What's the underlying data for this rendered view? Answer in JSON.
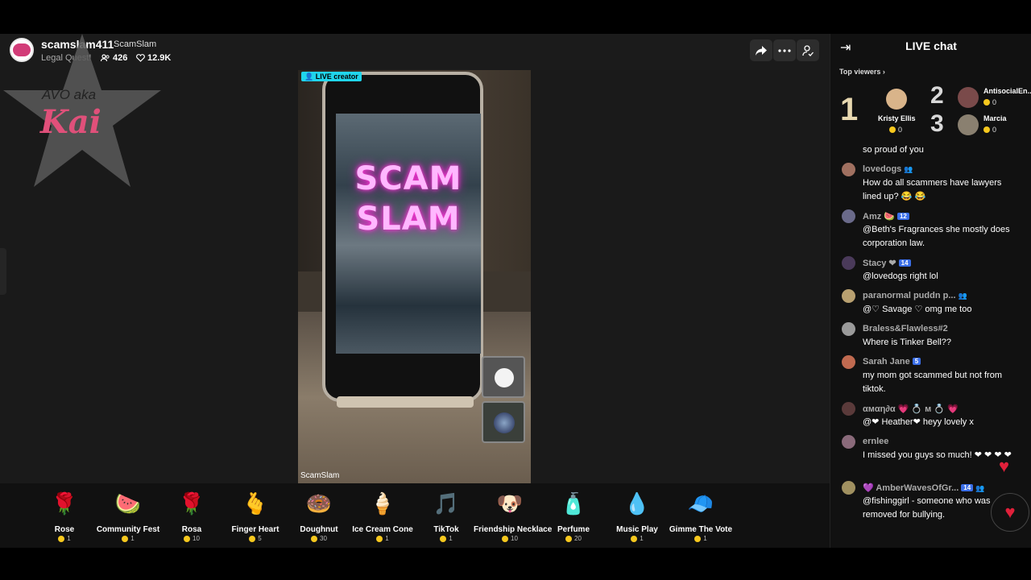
{
  "host": {
    "username": "scamslam411",
    "nickname": "ScamSlam",
    "subtitle": "Legal Quest!",
    "viewer_count": "426",
    "like_count": "12.9K"
  },
  "header_buttons": [
    "share-icon",
    "more-icon",
    "profile-icon"
  ],
  "watermark": {
    "line1": "AVO aka",
    "line2": "Kai"
  },
  "video": {
    "badge": "LIVE creator",
    "screen_text_1": "SCAM",
    "screen_text_2": "SLAM",
    "caption": "ScamSlam"
  },
  "gifts": [
    {
      "name": "Rose",
      "cost": "1",
      "icon": "🌹"
    },
    {
      "name": "Community Fest",
      "cost": "1",
      "icon": "🍉"
    },
    {
      "name": "Rosa",
      "cost": "10",
      "icon": "🌹"
    },
    {
      "name": "Finger Heart",
      "cost": "5",
      "icon": "🫰"
    },
    {
      "name": "Doughnut",
      "cost": "30",
      "icon": "🍩"
    },
    {
      "name": "Ice Cream Cone",
      "cost": "1",
      "icon": "🍦"
    },
    {
      "name": "TikTok",
      "cost": "1",
      "icon": "🎵"
    },
    {
      "name": "Friendship Necklace",
      "cost": "10",
      "icon": "🐶"
    },
    {
      "name": "Perfume",
      "cost": "20",
      "icon": "🧴"
    },
    {
      "name": "Music Play",
      "cost": "1",
      "icon": "💧"
    },
    {
      "name": "Gimme The Vote",
      "cost": "1",
      "icon": "🧢"
    }
  ],
  "chat": {
    "title": "LIVE chat",
    "top_viewers_label": "Top viewers",
    "top_viewers": [
      {
        "rank": "1",
        "name": "Kristy Ellis",
        "coins": "0"
      },
      {
        "rank": "2",
        "name": "AntisocialEn...",
        "coins": "0"
      },
      {
        "rank": "3",
        "name": "Marcia",
        "coins": "0"
      }
    ],
    "messages": [
      {
        "user": "",
        "text": "so proud of you"
      },
      {
        "user": "lovedogs",
        "text": "How do all scammers have lawyers lined up? 😂 😂"
      },
      {
        "user": "Amz 🍉",
        "level": "12",
        "text": "@Beth's Fragrances she mostly does corporation law."
      },
      {
        "user": "Stacy ❤",
        "level": "14",
        "text": "@lovedogs right lol"
      },
      {
        "user": "paranormal puddn p...",
        "text": "@♡ Savage ♡ omg me too"
      },
      {
        "user": "Braless&Flawless#2",
        "text": "Where is Tinker Bell??"
      },
      {
        "user": "Sarah Jane",
        "level": "5",
        "text": "my mom got scammed but not from tiktok."
      },
      {
        "user": "αмαη∂α 💗 💍 м 💍 💗",
        "text": "@❤ Heather❤ heyy lovely x"
      },
      {
        "user": "ernlee",
        "text": "I missed you guys so much! ❤ ❤ ❤ ❤"
      },
      {
        "user": "💜 AmberWavesOfGr...",
        "level": "14",
        "text": "@fishinggirl - someone who was removed for bullying."
      }
    ]
  },
  "colors": {
    "accent": "#20d5ec",
    "like": "#e0203a",
    "coin": "#f7c81e",
    "level_badge": "#3a6ee8"
  }
}
